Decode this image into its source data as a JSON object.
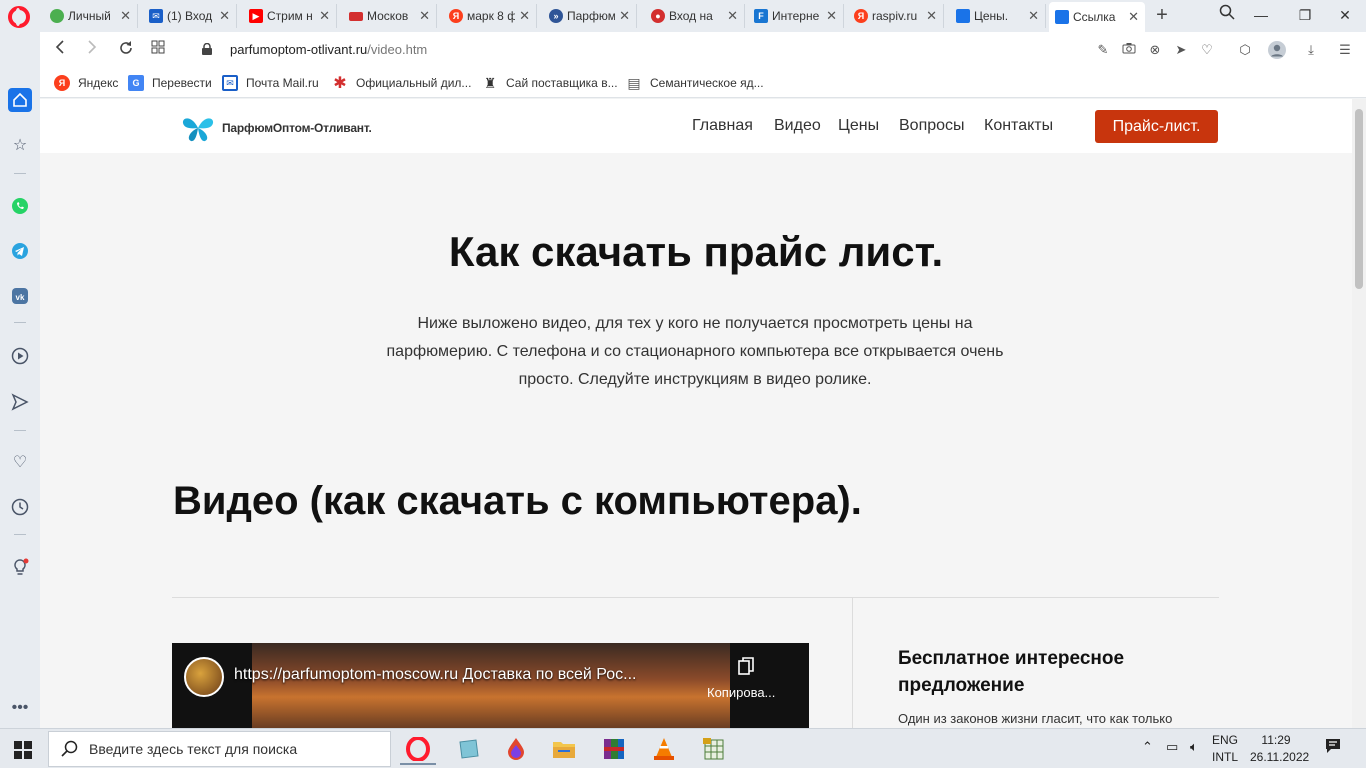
{
  "tabs": [
    {
      "label": "Личный",
      "color": "#4caf50"
    },
    {
      "label": "(1) Вход",
      "color": "#1a5fc8"
    },
    {
      "label": "Стрим н",
      "color": "#ff0000"
    },
    {
      "label": "Москов",
      "color": "#d32f2f"
    },
    {
      "label": "марк 8 ф",
      "color": "#fc3f1d"
    },
    {
      "label": "Парфюм",
      "color": "#2f5597"
    },
    {
      "label": "Вход на",
      "color": "#d32f2f"
    },
    {
      "label": "Интерне",
      "color": "#1976d2"
    },
    {
      "label": "raspiv.ru",
      "color": "#fc3f1d"
    },
    {
      "label": "Цены.",
      "color": "#1a73e8"
    },
    {
      "label": "Ссылка",
      "color": "#1a73e8"
    }
  ],
  "address": {
    "domain": "parfumoptom-otlivant.ru",
    "path": "/video.htm"
  },
  "bookmarks": [
    {
      "label": "Яндекс",
      "color": "#fc3f1d",
      "glyph": "Я"
    },
    {
      "label": "Перевести",
      "color": "#4285f4",
      "glyph": "G"
    },
    {
      "label": "Почта Mail.ru",
      "color": "#1a5fc8",
      "glyph": "✉"
    },
    {
      "label": "Официальный дил...",
      "color": "#d32f2f",
      "glyph": "✱"
    },
    {
      "label": "Сай поставщика в...",
      "color": "#333333",
      "glyph": "▪"
    },
    {
      "label": "Семантическое яд...",
      "color": "#555555",
      "glyph": "▤"
    }
  ],
  "site": {
    "logo_text": "ПарфюмОптом-Отливант.",
    "nav": [
      "Главная",
      "Видео",
      "Цены",
      "Вопросы",
      "Контакты"
    ],
    "cta": "Прайс-лист.",
    "heading": "Как скачать прайс лист.",
    "lead": "Ниже выложено видео,  для тех у кого не получается просмотреть цены на парфюмерию. С телефона и со стационарного компьютера все открывается очень просто. Следуйте инструкциям в видео ролике.",
    "section_heading": "Видео (как скачать с компьютера).",
    "video_title": "https://parfumoptom-moscow.ru Доставка по всей Рос...",
    "video_copy": "Копирова...",
    "side_title": "Бесплатное интересное предложение",
    "side_text": "Один из законов жизни гласит, что как только",
    "accent_color": "#c8350d"
  },
  "taskbar": {
    "search_placeholder": "Введите здесь текст для поиска",
    "lang1": "ENG",
    "lang2": "INTL",
    "time": "11:29",
    "date": "26.11.2022"
  }
}
